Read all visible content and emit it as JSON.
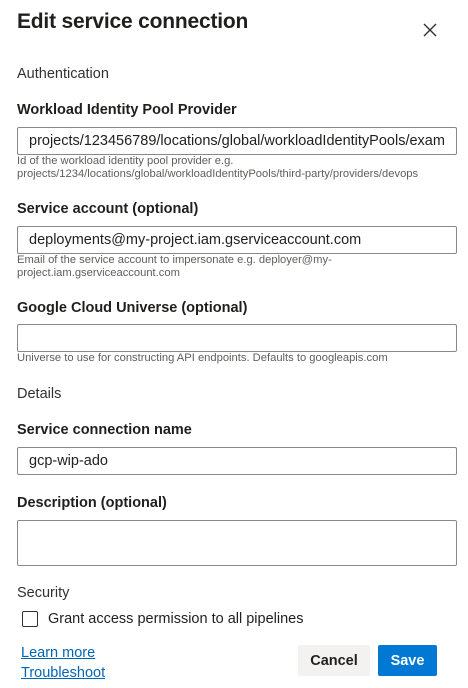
{
  "dialog": {
    "title": "Edit service connection",
    "close_icon": "close-icon"
  },
  "authentication": {
    "section_label": "Authentication",
    "provider": {
      "label": "Workload Identity Pool Provider",
      "value": "projects/123456789/locations/global/workloadIdentityPools/exam",
      "help": "Id of the workload identity pool provider e.g. projects/1234/locations/global/workloadIdentityPools/third-party/providers/devops"
    },
    "service_account": {
      "label": "Service account (optional)",
      "value": "deployments@my-project.iam.gserviceaccount.com",
      "help": "Email of the service account to impersonate e.g. deployer@my-project.iam.gserviceaccount.com"
    },
    "universe": {
      "label": "Google Cloud Universe (optional)",
      "value": "",
      "help": "Universe to use for constructing API endpoints. Defaults to googleapis.com"
    }
  },
  "details": {
    "section_label": "Details",
    "connection_name": {
      "label": "Service connection name",
      "value": "gcp-wip-ado"
    },
    "description": {
      "label": "Description (optional)",
      "value": ""
    }
  },
  "security": {
    "section_label": "Security",
    "grant_access_label": "Grant access permission to all pipelines",
    "grant_access_checked": false
  },
  "footer": {
    "learn_more": "Learn more",
    "troubleshoot": "Troubleshoot",
    "cancel_label": "Cancel",
    "save_label": "Save"
  },
  "colors": {
    "primary": "#0078d4",
    "link": "#0066b4",
    "secondary_button": "#f3f2f1"
  }
}
